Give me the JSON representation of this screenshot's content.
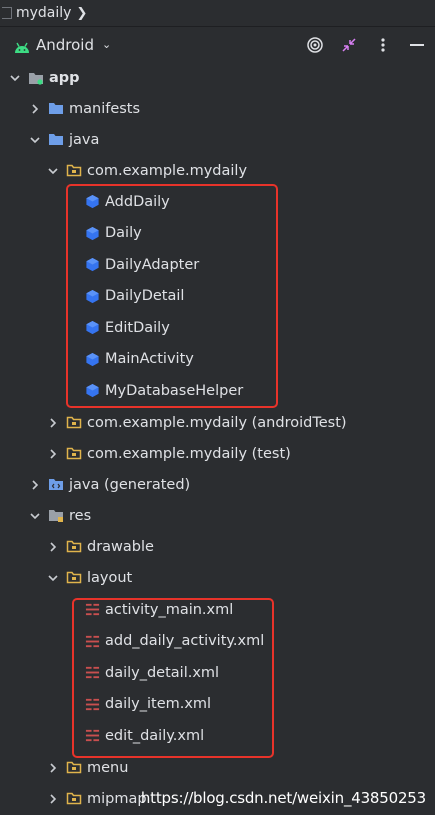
{
  "breadcrumb": {
    "project": "mydaily",
    "chevron": "chevron-right-icon"
  },
  "toolbar": {
    "view_label": "Android",
    "buttons": [
      "locate-icon",
      "collapse-icon",
      "more-icon",
      "hide-icon"
    ]
  },
  "tree": {
    "app": "app",
    "manifests": "manifests",
    "java": "java",
    "package_main": "com.example.mydaily",
    "classes": [
      "AddDaily",
      "Daily",
      "DailyAdapter",
      "DailyDetail",
      "EditDaily",
      "MainActivity",
      "MyDatabaseHelper"
    ],
    "package_android_test": "com.example.mydaily (androidTest)",
    "package_test": "com.example.mydaily (test)",
    "java_generated": "java (generated)",
    "res": "res",
    "drawable": "drawable",
    "layout": "layout",
    "layout_files": [
      "activity_main.xml",
      "add_daily_activity.xml",
      "daily_detail.xml",
      "daily_item.xml",
      "edit_daily.xml"
    ],
    "menu": "menu",
    "mipmap": "mipmap"
  },
  "colors": {
    "background": "#2b2d30",
    "text": "#dfe1e5",
    "highlight": "#e8332a",
    "class_icon": "#3574f0",
    "layout_icon": "#c94f4f",
    "folder": "#6e9ee8",
    "android": "#3ddc84"
  },
  "watermark": "https://blog.csdn.net/weixin_43850253"
}
